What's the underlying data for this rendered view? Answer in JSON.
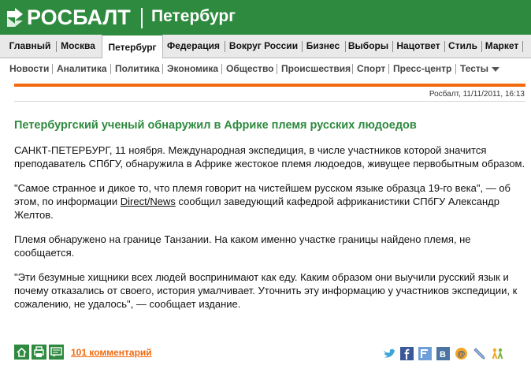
{
  "header": {
    "logo_text": "РОСБАЛТ",
    "region": "Петербург",
    "brand_color": "#2d8a3e"
  },
  "topnav": [
    {
      "label": "Главный"
    },
    {
      "label": "Москва"
    },
    {
      "label": "Петербург",
      "active": true
    },
    {
      "label": "Федерация"
    },
    {
      "label": "Вокруг России"
    },
    {
      "label": "Бизнес"
    },
    {
      "label": "Выборы"
    },
    {
      "label": "Нацответ"
    },
    {
      "label": "Стиль"
    },
    {
      "label": "Маркет"
    }
  ],
  "subnav": [
    {
      "label": "Новости"
    },
    {
      "label": "Аналитика"
    },
    {
      "label": "Политика"
    },
    {
      "label": "Экономика"
    },
    {
      "label": "Общество"
    },
    {
      "label": "Происшествия"
    },
    {
      "label": "Спорт"
    },
    {
      "label": "Пресс-центр"
    },
    {
      "label": "Тесты"
    }
  ],
  "article": {
    "meta": "Росбалт, 11/11/2011, 16:13",
    "title": "Петербургский ученый обнаружил в Африке племя русских людоедов",
    "p1": "САНКТ-ПЕТЕРБУРГ, 11 ноября. Международная экспедиция, в числе участников которой значится преподаватель СПбГУ, обнаружила в Африке жестокое племя людоедов, живущее первобытным образом.",
    "p2_before": "\"Самое странное и дикое то, что племя говорит на чистейшем русском языке образца 19-го века\", — об этом, по информации ",
    "p2_link": "Direct/News",
    "p2_after": " сообщил заведующий кафедрой африканистики СПбГУ Александр Желтов.",
    "p3": "Племя обнаружено на границе Танзании. На каком именно участке границы найдено племя, не сообщается.",
    "p4": "\"Эти безумные хищники всех людей воспринимают как еду. Каким образом они выучили русский язык и почему отказались от своего, история умалчивает. Уточнить эту информацию у участников экспедиции, к сожалению, не удалось\", — сообщает издание.",
    "comments": "101 комментарий"
  },
  "social_icons": [
    "twitter-icon",
    "facebook-icon",
    "friendfeed-icon",
    "vkontakte-icon",
    "mailru-icon",
    "livejournal-icon",
    "odnoklassniki-icon"
  ]
}
